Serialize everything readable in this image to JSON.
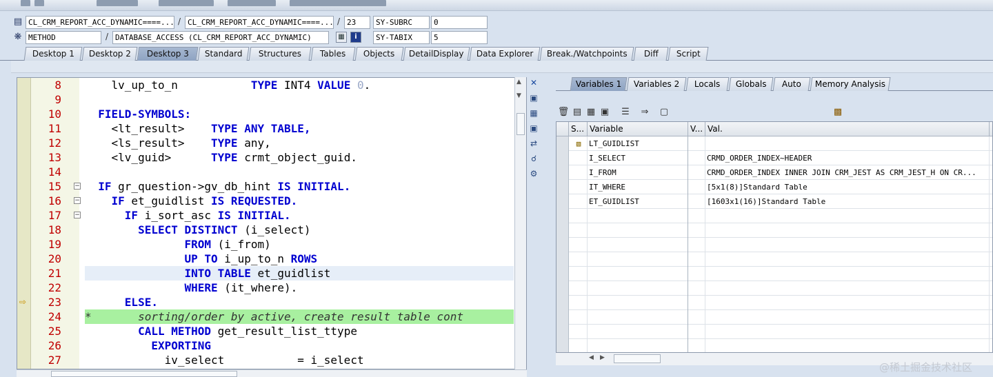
{
  "header": {
    "row1": {
      "field1": "CL_CRM_REPORT_ACC_DYNAMIC====...",
      "sep1": "/",
      "field2": "CL_CRM_REPORT_ACC_DYNAMIC====...",
      "sep2": "/",
      "field3": "23",
      "sysname": "SY-SUBRC",
      "sysval": "0"
    },
    "row2": {
      "field1": "METHOD",
      "sep1": "/",
      "field2": "DATABASE_ACCESS (CL_CRM_REPORT_ACC_DYNAMIC)",
      "info_label": "i",
      "sysname": "SY-TABIX",
      "sysval": "5"
    }
  },
  "tabs": [
    {
      "label": "Desktop 1"
    },
    {
      "label": "Desktop 2"
    },
    {
      "label": "Desktop 3"
    },
    {
      "label": "Standard"
    },
    {
      "label": "Structures"
    },
    {
      "label": "Tables"
    },
    {
      "label": "Objects"
    },
    {
      "label": "DetailDisplay"
    },
    {
      "label": "Data Explorer"
    },
    {
      "label": "Break./Watchpoints"
    },
    {
      "label": "Diff"
    },
    {
      "label": "Script"
    }
  ],
  "active_tab": "Desktop 3",
  "editor": {
    "lines": [
      {
        "n": "8",
        "segs": [
          [
            "t",
            "    lv_up_to_n           "
          ],
          [
            "k",
            "TYPE"
          ],
          [
            "t",
            " INT4 "
          ],
          [
            "k",
            "VALUE"
          ],
          [
            "t",
            " "
          ],
          [
            "n",
            "0"
          ],
          [
            "t",
            "."
          ]
        ]
      },
      {
        "n": "9",
        "segs": []
      },
      {
        "n": "10",
        "segs": [
          [
            "t",
            "  "
          ],
          [
            "k",
            "FIELD-SYMBOLS:"
          ]
        ]
      },
      {
        "n": "11",
        "segs": [
          [
            "t",
            "    <lt_result>    "
          ],
          [
            "k",
            "TYPE ANY TABLE,"
          ]
        ]
      },
      {
        "n": "12",
        "segs": [
          [
            "t",
            "    <ls_result>    "
          ],
          [
            "k",
            "TYPE"
          ],
          [
            "t",
            " any,"
          ]
        ]
      },
      {
        "n": "13",
        "segs": [
          [
            "t",
            "    <lv_guid>      "
          ],
          [
            "k",
            "TYPE"
          ],
          [
            "t",
            " crmt_object_guid."
          ]
        ]
      },
      {
        "n": "14",
        "segs": []
      },
      {
        "n": "15",
        "segs": [
          [
            "t",
            "  "
          ],
          [
            "k",
            "IF"
          ],
          [
            "t",
            " gr_question->gv_db_hint "
          ],
          [
            "k",
            "IS INITIAL."
          ]
        ]
      },
      {
        "n": "16",
        "segs": [
          [
            "t",
            "    "
          ],
          [
            "k",
            "IF"
          ],
          [
            "t",
            " et_guidlist "
          ],
          [
            "k",
            "IS REQUESTED."
          ]
        ]
      },
      {
        "n": "17",
        "segs": [
          [
            "t",
            "      "
          ],
          [
            "k",
            "IF"
          ],
          [
            "t",
            " i_sort_asc "
          ],
          [
            "k",
            "IS INITIAL."
          ]
        ]
      },
      {
        "n": "18",
        "segs": [
          [
            "t",
            "        "
          ],
          [
            "k",
            "SELECT DISTINCT"
          ],
          [
            "t",
            " (i_select)"
          ]
        ]
      },
      {
        "n": "19",
        "segs": [
          [
            "t",
            "               "
          ],
          [
            "k",
            "FROM"
          ],
          [
            "t",
            " (i_from)"
          ]
        ]
      },
      {
        "n": "20",
        "segs": [
          [
            "t",
            "               "
          ],
          [
            "k",
            "UP TO"
          ],
          [
            "t",
            " i_up_to_n "
          ],
          [
            "k",
            "ROWS"
          ]
        ]
      },
      {
        "n": "21",
        "segs": [
          [
            "t",
            "               "
          ],
          [
            "k",
            "INTO TABLE"
          ],
          [
            "t",
            " et_guidlist"
          ]
        ]
      },
      {
        "n": "22",
        "segs": [
          [
            "t",
            "               "
          ],
          [
            "k",
            "WHERE"
          ],
          [
            "t",
            " (it_where)."
          ]
        ]
      },
      {
        "n": "23",
        "segs": [
          [
            "t",
            "      "
          ],
          [
            "k",
            "ELSE."
          ]
        ]
      },
      {
        "n": "24",
        "segs": [
          [
            "c",
            "*       sorting/order by active, create result table cont"
          ]
        ]
      },
      {
        "n": "25",
        "segs": [
          [
            "t",
            "        "
          ],
          [
            "k",
            "CALL METHOD"
          ],
          [
            "t",
            " get_result_list_ttype"
          ]
        ]
      },
      {
        "n": "26",
        "segs": [
          [
            "t",
            "          "
          ],
          [
            "k",
            "EXPORTING"
          ]
        ]
      },
      {
        "n": "27",
        "segs": [
          [
            "t",
            "            iv_select           = i_select"
          ]
        ]
      }
    ]
  },
  "right_tabs": [
    {
      "label": "Variables 1"
    },
    {
      "label": "Variables 2"
    },
    {
      "label": "Locals"
    },
    {
      "label": "Globals"
    },
    {
      "label": "Auto"
    },
    {
      "label": "Memory Analysis"
    }
  ],
  "active_right_tab": "Variables 1",
  "variables": {
    "headers": [
      "S...",
      "Variable",
      "V...",
      "Val."
    ],
    "rows": [
      {
        "variable": "LT_GUIDLIST",
        "value": ""
      },
      {
        "variable": "I_SELECT",
        "value": "CRMD_ORDER_INDEX~HEADER"
      },
      {
        "variable": "I_FROM",
        "value": "CRMD_ORDER_INDEX  INNER JOIN CRM_JEST AS CRM_JEST_H ON CR..."
      },
      {
        "variable": "IT_WHERE",
        "value": "[5x1(8)]Standard Table"
      },
      {
        "variable": "ET_GUIDLIST",
        "value": "[1603x1(16)]Standard Table"
      }
    ]
  },
  "watermark": "@稀土掘金技术社区",
  "colors": {
    "keyword": "#0000d0",
    "line_number": "#c00000",
    "comment_bg": "#a8f0a0",
    "cursor_line_bg": "#e6eef8"
  }
}
